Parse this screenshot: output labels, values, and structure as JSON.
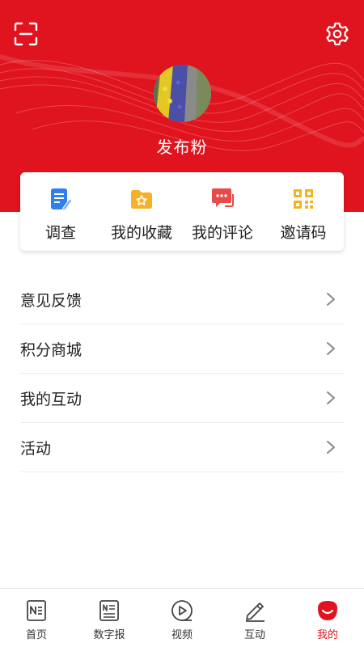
{
  "colors": {
    "brand": "#e0141e",
    "divider": "#ececec",
    "text": "#222222"
  },
  "header": {
    "scan_icon": "scan-icon",
    "settings_icon": "gear-icon",
    "username": "发布粉"
  },
  "quick_actions": [
    {
      "label": "调查",
      "icon": "survey-icon"
    },
    {
      "label": "我的收藏",
      "icon": "favorites-folder-icon"
    },
    {
      "label": "我的评论",
      "icon": "comment-icon"
    },
    {
      "label": "邀请码",
      "icon": "qr-code-icon"
    }
  ],
  "menu": [
    {
      "label": "意见反馈"
    },
    {
      "label": "积分商城"
    },
    {
      "label": "我的互动"
    },
    {
      "label": "活动"
    }
  ],
  "tabbar": [
    {
      "label": "首页",
      "icon": "home-news-icon"
    },
    {
      "label": "数字报",
      "icon": "digital-paper-icon"
    },
    {
      "label": "视频",
      "icon": "video-play-icon"
    },
    {
      "label": "互动",
      "icon": "pen-icon"
    },
    {
      "label": "我的",
      "icon": "profile-smile-icon",
      "active": true
    }
  ]
}
